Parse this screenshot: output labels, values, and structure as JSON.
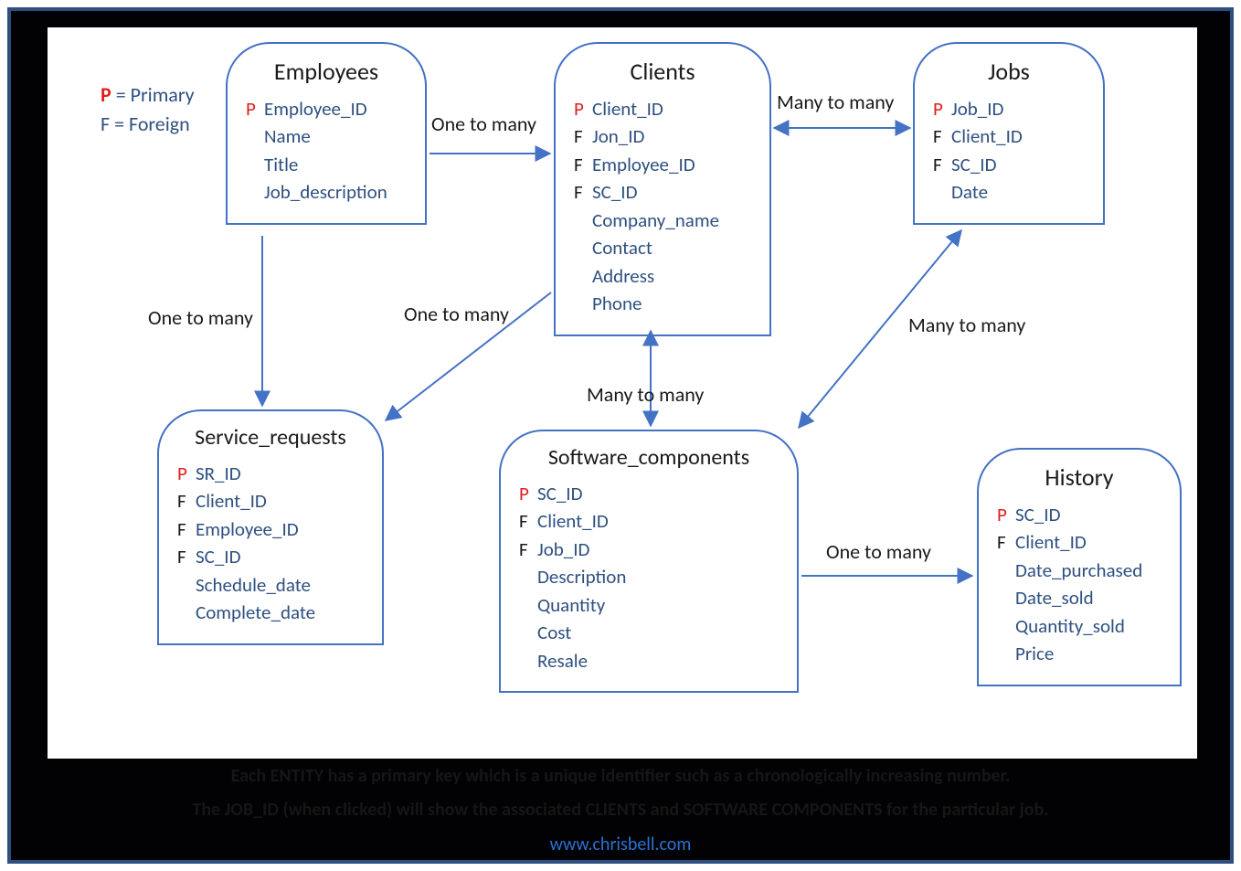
{
  "legend": {
    "primary_key_letter": "P",
    "primary_label": " = Primary",
    "foreign_key_letter": "F",
    "foreign_label": " = Foreign"
  },
  "entities": {
    "employees": {
      "title": "Employees",
      "attrs": [
        {
          "key": "P",
          "name": "Employee_ID"
        },
        {
          "key": "",
          "name": "Name"
        },
        {
          "key": "",
          "name": "Title"
        },
        {
          "key": "",
          "name": "Job_description"
        }
      ]
    },
    "clients": {
      "title": "Clients",
      "attrs": [
        {
          "key": "P",
          "name": "Client_ID"
        },
        {
          "key": "F",
          "name": "Jon_ID"
        },
        {
          "key": "F",
          "name": "Employee_ID"
        },
        {
          "key": "F",
          "name": "SC_ID"
        },
        {
          "key": "",
          "name": "Company_name"
        },
        {
          "key": "",
          "name": "Contact"
        },
        {
          "key": "",
          "name": "Address"
        },
        {
          "key": "",
          "name": "Phone"
        }
      ]
    },
    "jobs": {
      "title": "Jobs",
      "attrs": [
        {
          "key": "P",
          "name": "Job_ID"
        },
        {
          "key": "F",
          "name": "Client_ID"
        },
        {
          "key": "F",
          "name": "SC_ID"
        },
        {
          "key": "",
          "name": "Date"
        }
      ]
    },
    "service_requests": {
      "title": "Service_requests",
      "attrs": [
        {
          "key": "P",
          "name": "SR_ID"
        },
        {
          "key": "F",
          "name": "Client_ID"
        },
        {
          "key": "F",
          "name": "Employee_ID"
        },
        {
          "key": "F",
          "name": "SC_ID"
        },
        {
          "key": "",
          "name": "Schedule_date"
        },
        {
          "key": "",
          "name": "Complete_date"
        }
      ]
    },
    "software_components": {
      "title": "Software_components",
      "attrs": [
        {
          "key": "P",
          "name": "SC_ID"
        },
        {
          "key": "F",
          "name": "Client_ID"
        },
        {
          "key": "F",
          "name": "Job_ID"
        },
        {
          "key": "",
          "name": "Description"
        },
        {
          "key": "",
          "name": "Quantity"
        },
        {
          "key": "",
          "name": "Cost"
        },
        {
          "key": "",
          "name": "Resale"
        }
      ]
    },
    "history": {
      "title": "History",
      "attrs": [
        {
          "key": "P",
          "name": "SC_ID"
        },
        {
          "key": "F",
          "name": "Client_ID"
        },
        {
          "key": "",
          "name": "Date_purchased"
        },
        {
          "key": "",
          "name": "Date_sold"
        },
        {
          "key": "",
          "name": "Quantity_sold"
        },
        {
          "key": "",
          "name": "Price"
        }
      ]
    }
  },
  "relationships": {
    "emp_to_clients": "One to many",
    "clients_to_jobs": "Many to many",
    "emp_to_sr": "One to many",
    "clients_to_sr": "One to many",
    "clients_to_sc": "Many to many",
    "jobs_to_sc": "Many to many",
    "sc_to_history": "One to many"
  },
  "footer": {
    "line1": "Each ENTITY has a primary key which is a unique identifier such as a chronologically increasing number.",
    "line2": "The JOB_ID (when clicked) will show the associated CLIENTS and SOFTWARE COMPONENTS for the particular job.",
    "link": "www.chrisbell.com"
  },
  "colors": {
    "frame": "#2e5080",
    "entity_border": "#4472c4",
    "arrow": "#4472c4",
    "pk": "#e02020",
    "text_dark": "#1a1a1a",
    "text_blue": "#2e5080",
    "link": "#2a72d4"
  }
}
